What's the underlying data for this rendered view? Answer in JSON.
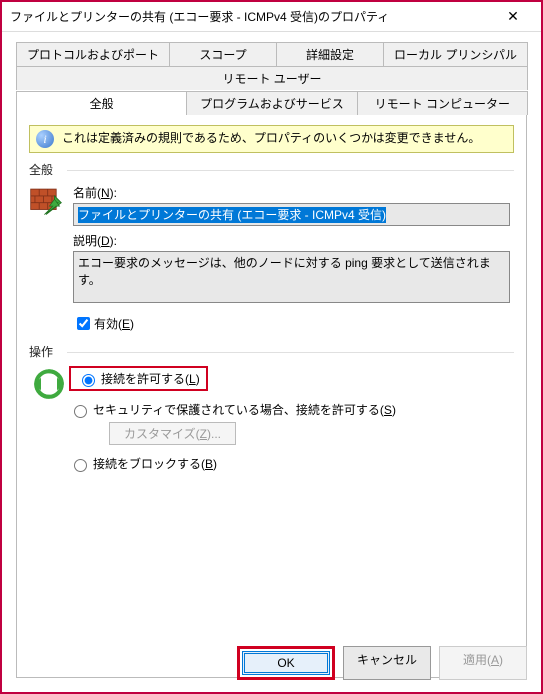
{
  "window": {
    "title": "ファイルとプリンターの共有 (エコー要求 - ICMPv4 受信)のプロパティ",
    "close_glyph": "✕"
  },
  "tabs_row1": [
    "プロトコルおよびポート",
    "スコープ",
    "詳細設定",
    "ローカル プリンシパル",
    "リモート ユーザー"
  ],
  "tabs_row2": [
    "全般",
    "プログラムおよびサービス",
    "リモート コンピューター"
  ],
  "active_tab_index_row2": 0,
  "info_banner": {
    "icon": "i",
    "text": "これは定義済みの規則であるため、プロパティのいくつかは変更できません。"
  },
  "general": {
    "section_label": "全般",
    "name_label": "名前(N):",
    "name_label_underline": "N",
    "name_value": "ファイルとプリンターの共有 (エコー要求 - ICMPv4 受信)",
    "desc_label": "説明(D):",
    "desc_label_underline": "D",
    "desc_value": "エコー要求のメッセージは、他のノードに対する ping 要求として送信されます。",
    "enabled_label": "有効(E)",
    "enabled_label_underline": "E",
    "enabled_checked": true
  },
  "action": {
    "section_label": "操作",
    "options": [
      {
        "label": "接続を許可する(L)",
        "underline": "L",
        "checked": true,
        "highlighted": true
      },
      {
        "label": "セキュリティで保護されている場合、接続を許可する(S)",
        "underline": "S",
        "checked": false,
        "highlighted": false
      },
      {
        "label": "接続をブロックする(B)",
        "underline": "B",
        "checked": false,
        "highlighted": false
      }
    ],
    "customize_label": "カスタマイズ(Z)...",
    "customize_underline": "Z",
    "customize_enabled": false
  },
  "buttons": {
    "ok": "OK",
    "cancel": "キャンセル",
    "apply": "適用(A)",
    "apply_underline": "A",
    "apply_enabled": false,
    "ok_highlighted": true
  }
}
